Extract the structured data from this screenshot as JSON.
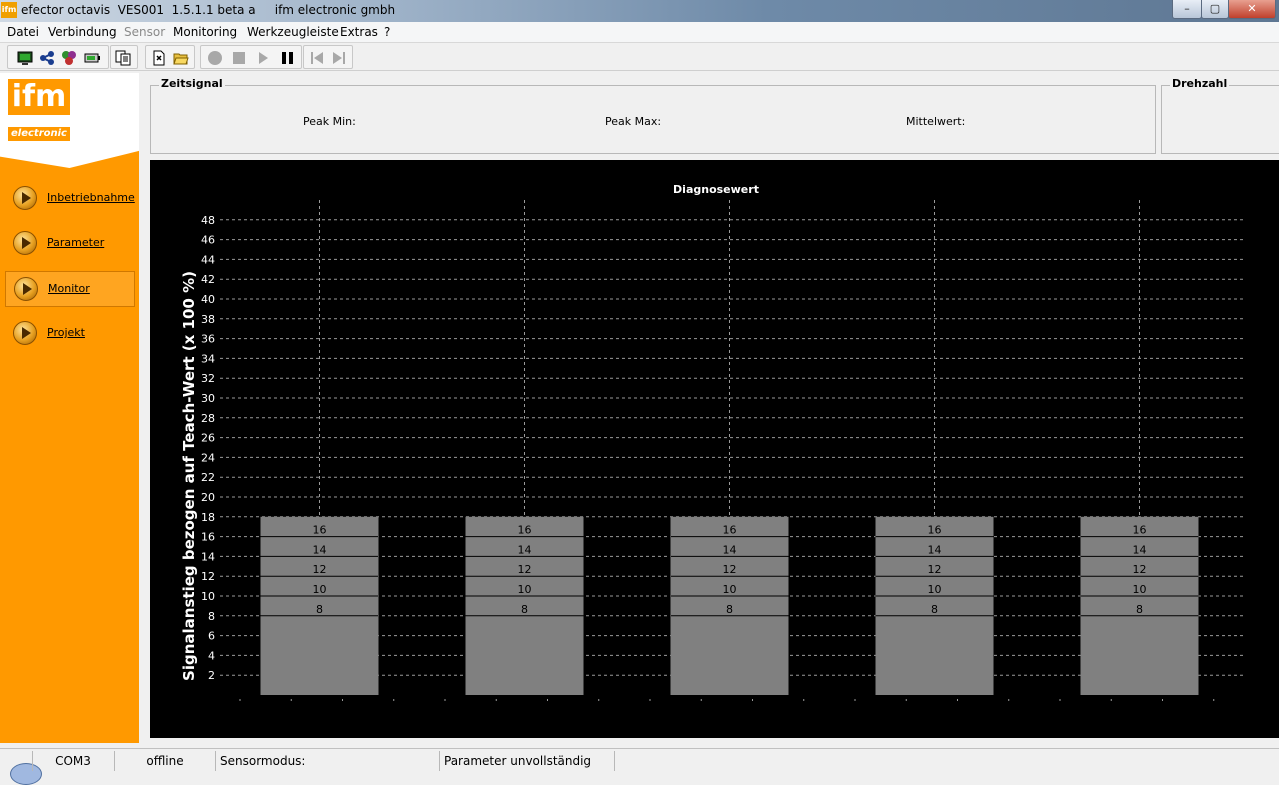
{
  "window": {
    "title": "efector octavis  VES001  1.5.1.1 beta a     ifm electronic gmbh",
    "app_icon_text": "ifm",
    "minimize": "–",
    "maximize": "▢",
    "close": "✕"
  },
  "menu": [
    "Datei",
    "Verbindung",
    "Sensor",
    "Monitoring",
    "Werkzeugleiste",
    "Extras",
    "?"
  ],
  "menu_disabled": [
    "Sensor"
  ],
  "toolbar_icons": [
    "monitor-icon",
    "network-icon",
    "sensor-icon",
    "battery-icon",
    "copy-icon",
    "new-document-icon",
    "open-folder-icon",
    "record-icon",
    "stop-icon",
    "play-icon",
    "pause-icon",
    "skip-back-icon",
    "skip-forward-icon"
  ],
  "logo": {
    "top": "ifm",
    "bottom": "electronic"
  },
  "sidebar": [
    {
      "label": "Inbetriebnahme",
      "active": false
    },
    {
      "label": "Parameter",
      "active": false
    },
    {
      "label": "Monitor",
      "active": true
    },
    {
      "label": "Projekt",
      "active": false
    }
  ],
  "zeitsignal": {
    "title": "Zeitsignal",
    "peak_min": "Peak Min:",
    "peak_max": "Peak Max:",
    "mittelwert": "Mittelwert:"
  },
  "drehzahl": {
    "title": "Drehzahl"
  },
  "status": {
    "port": "COM3",
    "connection": "offline",
    "sensormodus": "Sensormodus:",
    "parameter": "Parameter unvollständig"
  },
  "colors": {
    "sidebar": "#ff9900",
    "chart_bg": "#000000",
    "bar": "#808080",
    "grid": "#9a9a9a"
  },
  "chart_data": {
    "type": "bar",
    "title": "Diagnosewert",
    "ylabel": "Signalanstieg bezogen auf Teach-Wert (x 100 %)",
    "xlabel": "",
    "ylim": [
      0,
      50
    ],
    "yticks": [
      2,
      4,
      6,
      8,
      10,
      12,
      14,
      16,
      18,
      20,
      22,
      24,
      26,
      28,
      30,
      32,
      34,
      36,
      38,
      40,
      42,
      44,
      46,
      48
    ],
    "ytick_labels": [
      "2",
      "4",
      "6",
      "8",
      "10",
      "12",
      "14",
      "16",
      "18",
      "20",
      "22",
      "24",
      "26",
      "28",
      "30",
      "32",
      "34",
      "36",
      "38",
      "40",
      "42",
      "44",
      "46",
      "48"
    ],
    "grid": true,
    "values": [
      18,
      18,
      18,
      18,
      18
    ],
    "threshold_lines": [
      8,
      10,
      12,
      14,
      16
    ],
    "threshold_labels": [
      "8",
      "10",
      "12",
      "14",
      "16"
    ]
  }
}
